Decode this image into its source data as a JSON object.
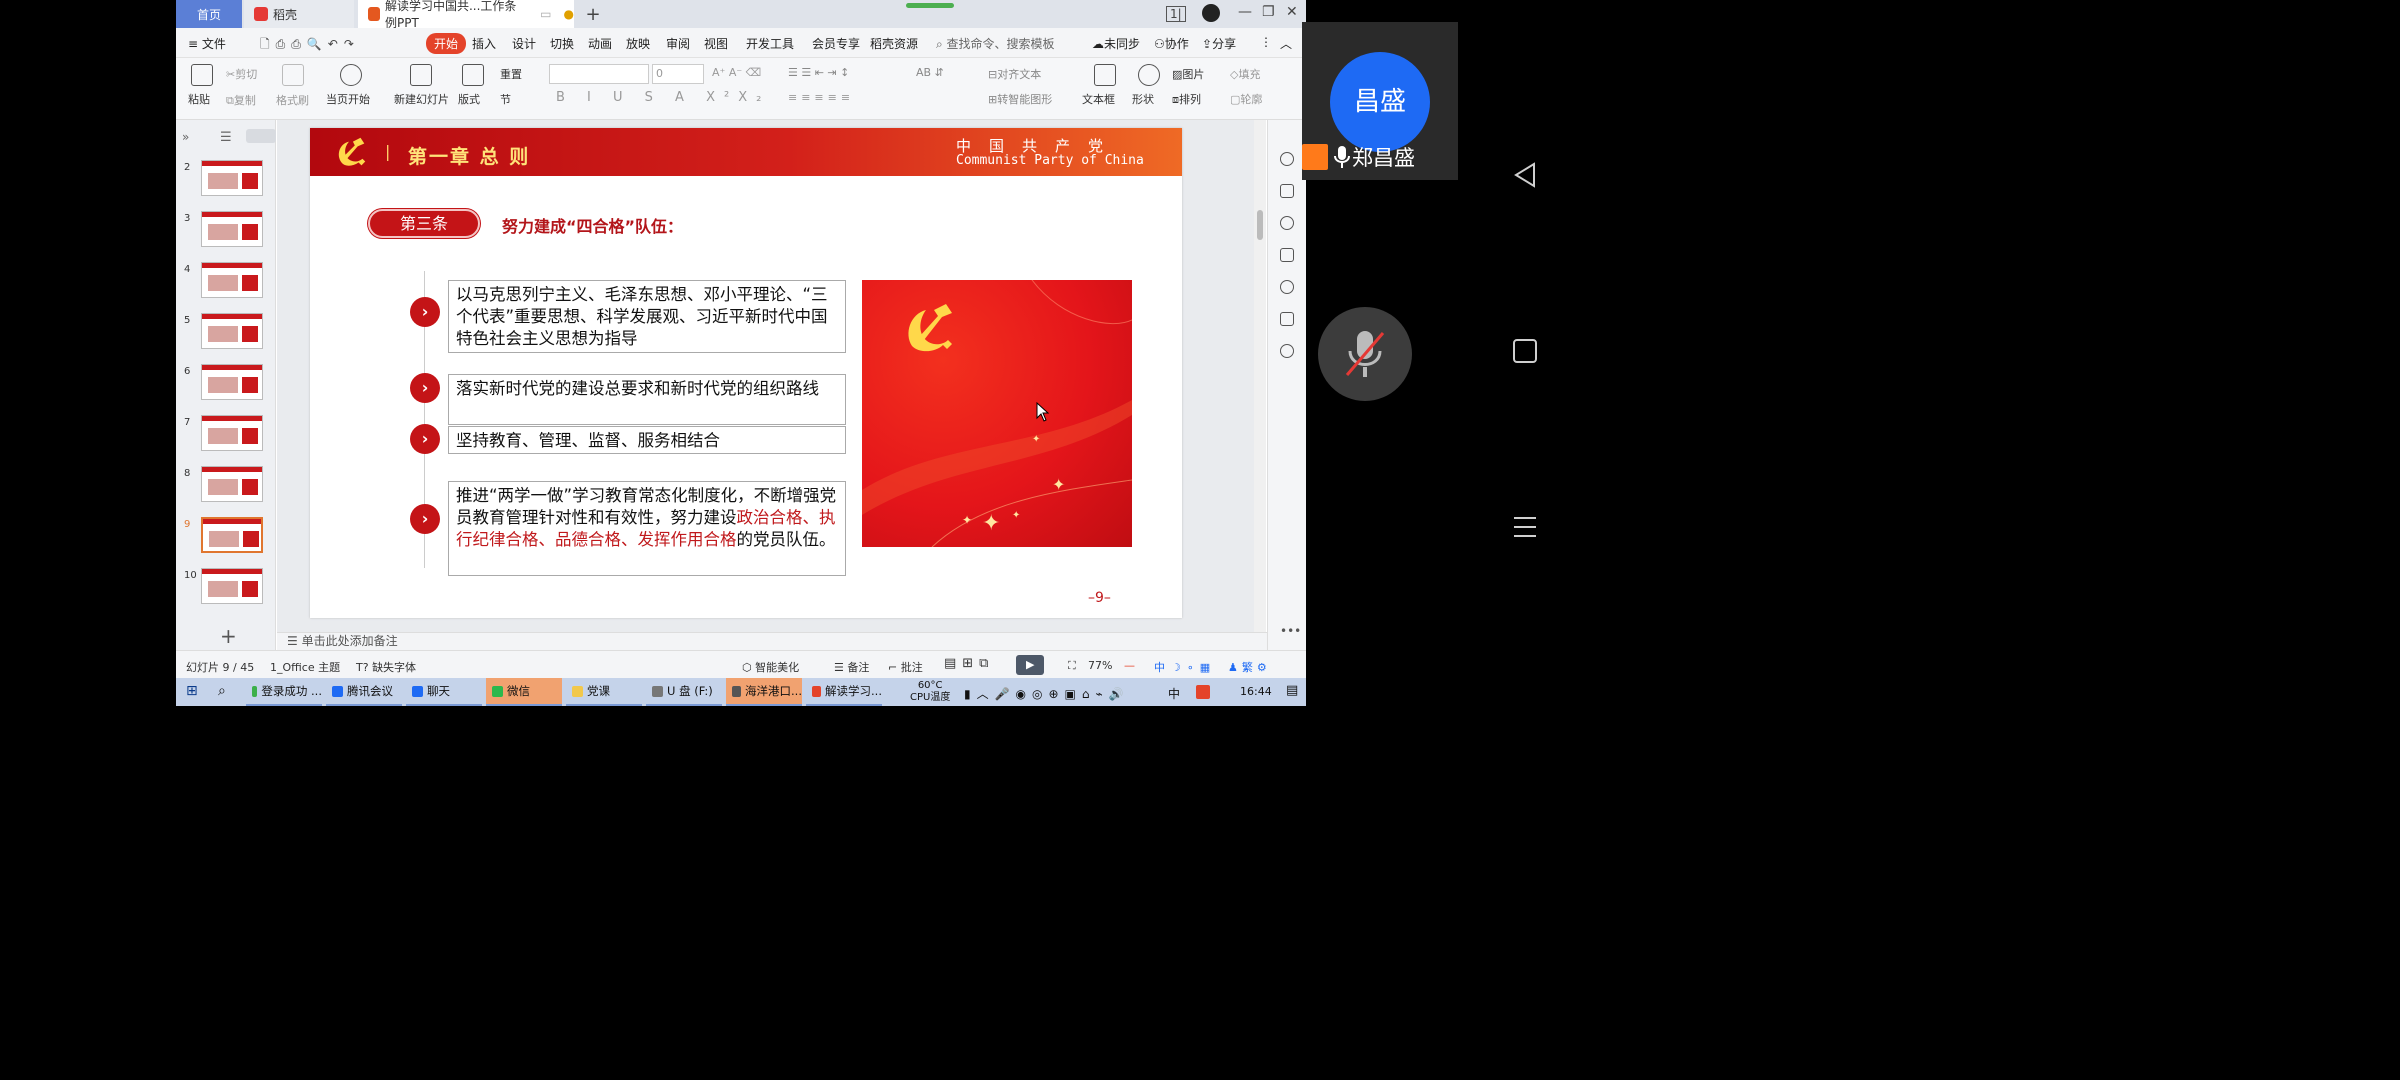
{
  "titlebar": {
    "home_tab": "首页",
    "dk_tab": "稻壳",
    "doc_tab": "解读学习中国共...工作条例PPT",
    "plus": "+"
  },
  "menubar": {
    "file": "≡ 文件",
    "items": [
      "开始",
      "插入",
      "设计",
      "切换",
      "动画",
      "放映",
      "审阅",
      "视图",
      "开发工具",
      "会员专享",
      "稻壳资源"
    ],
    "search": "查找命令、搜索模板",
    "unsynced": "未同步",
    "collab": "协作",
    "share": "分享"
  },
  "ribbon": {
    "paste": "粘贴",
    "cut": "剪切",
    "copy": "复制",
    "format_painter": "格式刷",
    "play_current": "当页开始",
    "new_slide": "新建幻灯片",
    "layout": "版式",
    "reset": "重置",
    "section": "节",
    "font_size": "0",
    "align_text": "对齐文本",
    "smart_shape": "转智能图形",
    "textbox": "文本框",
    "shape": "形状",
    "picture": "图片",
    "arrange": "排列",
    "fill": "填充",
    "outline": "轮廓",
    "style_btns": [
      "B",
      "I",
      "U",
      "S",
      "A",
      "X²",
      "X₂"
    ]
  },
  "thumbnails": [
    "2",
    "3",
    "4",
    "5",
    "6",
    "7",
    "8",
    "9",
    "10"
  ],
  "slide": {
    "chapter": "第一章  总  则",
    "cn_name": "中国共产党",
    "en_name": "Communist Party of China",
    "article_label": "第三条",
    "article_title": "努力建成“四合格”队伍：",
    "items": [
      {
        "text": "以马克思列宁主义、毛泽东思想、邓小平理论、“三个代表”重要思想、科学发展观、习近平新时代中国特色社会主义思想为指导"
      },
      {
        "text": "落实新时代党的建设总要求和新时代党的组织路线"
      },
      {
        "text": "坚持教育、管理、监督、服务相结合"
      },
      {
        "text_a": "推进“两学一做”学习教育常态化制度化，不断增强党员教育管理针对性和有效性，努力建设",
        "text_hl": "政治合格、执行纪律合格、品德合格、发挥作用合格",
        "text_b": "的党员队伍。"
      }
    ],
    "bullet_glyph": "›",
    "page_num": "–9–"
  },
  "notes_hint": "单击此处添加备注",
  "statusbar": {
    "slide_pos": "幻灯片 9 / 45",
    "theme": "1_Office 主题",
    "missing_font": "缺失字体",
    "beautify": "智能美化",
    "notes": "备注",
    "comments": "批注",
    "zoom": "77%"
  },
  "taskbar": {
    "apps": [
      "登录成功 ...",
      "腾讯会议",
      "聊天",
      "微信",
      "党课",
      "U 盘 (F:)",
      "海洋港口...",
      "解读学习..."
    ],
    "cpu_temp": "60°C",
    "cpu_label": "CPU温度",
    "ime": "中",
    "time": "16:44"
  },
  "meeting": {
    "avatar_text": "昌盛",
    "name": "郑昌盛"
  },
  "colors": {
    "accent_red": "#c41417",
    "wps_tab_orange": "#e4432a",
    "meeting_blue": "#1e6af4"
  }
}
